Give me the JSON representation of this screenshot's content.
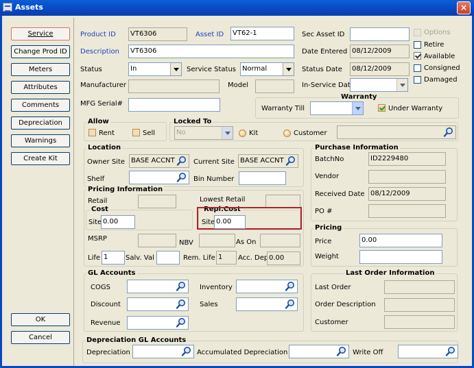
{
  "window": {
    "title": "Assets",
    "close_icon": "×"
  },
  "left_buttons": [
    "Service",
    "Change Prod ID",
    "Meters",
    "Attributes",
    "Comments",
    "Depreciation",
    "Warnings",
    "Create Kit"
  ],
  "bottom_buttons": {
    "ok": "OK",
    "cancel": "Cancel"
  },
  "header": {
    "product_id_label": "Product ID",
    "product_id": "VT6306",
    "asset_id_label": "Asset ID",
    "asset_id": "VT62-1",
    "sec_asset_id_label": "Sec Asset ID",
    "sec_asset_id": "",
    "description_label": "Description",
    "description": "VT6306",
    "date_entered_label": "Date Entered",
    "date_entered": "08/12/2009",
    "status_label": "Status",
    "status": "In",
    "service_status_label": "Service Status",
    "service_status": "Normal",
    "status_date_label": "Status Date",
    "status_date": "08/12/2009",
    "manufacturer_label": "Manufacturer",
    "manufacturer": "",
    "model_label": "Model",
    "model": "",
    "in_service_date_label": "In-Service Date",
    "in_service_date": "",
    "mfg_serial_label": "MFG Serial#",
    "mfg_serial": ""
  },
  "flags": {
    "options": "Options",
    "retire": "Retire",
    "available": "Available",
    "consigned": "Consigned",
    "damaged": "Damaged"
  },
  "warranty": {
    "title": "Warranty",
    "till_label": "Warranty Till",
    "till": "",
    "under_warranty": "Under Warranty"
  },
  "allow": {
    "title": "Allow",
    "rent": "Rent",
    "sell": "Sell"
  },
  "locked_to": {
    "title": "Locked To",
    "value": "No",
    "kit": "Kit",
    "customer": "Customer",
    "customer_value": ""
  },
  "location": {
    "title": "Location",
    "owner_site_label": "Owner Site",
    "owner_site": "BASE ACCNT",
    "current_site_label": "Current Site",
    "current_site": "BASE ACCNT",
    "shelf_label": "Shelf",
    "shelf": "",
    "bin_number_label": "Bin Number",
    "bin_number": ""
  },
  "purchase": {
    "title": "Purchase Information",
    "batch_label": "BatchNo",
    "batch": "ID2229480",
    "vendor_label": "Vendor",
    "vendor": "",
    "received_label": "Received Date",
    "received": "08/12/2009",
    "po_label": "PO #",
    "po": ""
  },
  "pricing_info": {
    "title": "Pricing Information",
    "retail_label": "Retail",
    "retail": "",
    "lowest_retail_label": "Lowest Retail",
    "lowest_retail": "",
    "cost_title": "Cost",
    "cost_site_label": "Site",
    "cost_site": "0.00",
    "repl_title": "Repl.Cost",
    "repl_site_label": "Site",
    "repl_site": "0.00",
    "msrp_label": "MSRP",
    "msrp": "",
    "nbv_label": "NBV",
    "nbv": "",
    "as_on_label": "As On",
    "as_on": "",
    "life_label": "Life",
    "life": "1",
    "salv_label": "Salv. Val",
    "salv": "",
    "rem_life_label": "Rem. Life",
    "rem_life": "1",
    "acc_dep_label": "Acc. Dep",
    "acc_dep": "0.00"
  },
  "pricing": {
    "title": "Pricing",
    "price_label": "Price",
    "price": "0.00",
    "weight_label": "Weight",
    "weight": ""
  },
  "gl": {
    "title": "GL Accounts",
    "cogs": "COGS",
    "inventory": "Inventory",
    "discount": "Discount",
    "sales": "Sales",
    "revenue": "Revenue"
  },
  "last_order": {
    "title": "Last Order Information",
    "last_order": "Last Order",
    "order_desc": "Order Description",
    "customer": "Customer"
  },
  "dep_gl": {
    "title": "Depreciation GL Accounts",
    "depreciation": "Depreciation",
    "accumulated": "Accumulated Depreciation",
    "write_off": "Write Off"
  }
}
